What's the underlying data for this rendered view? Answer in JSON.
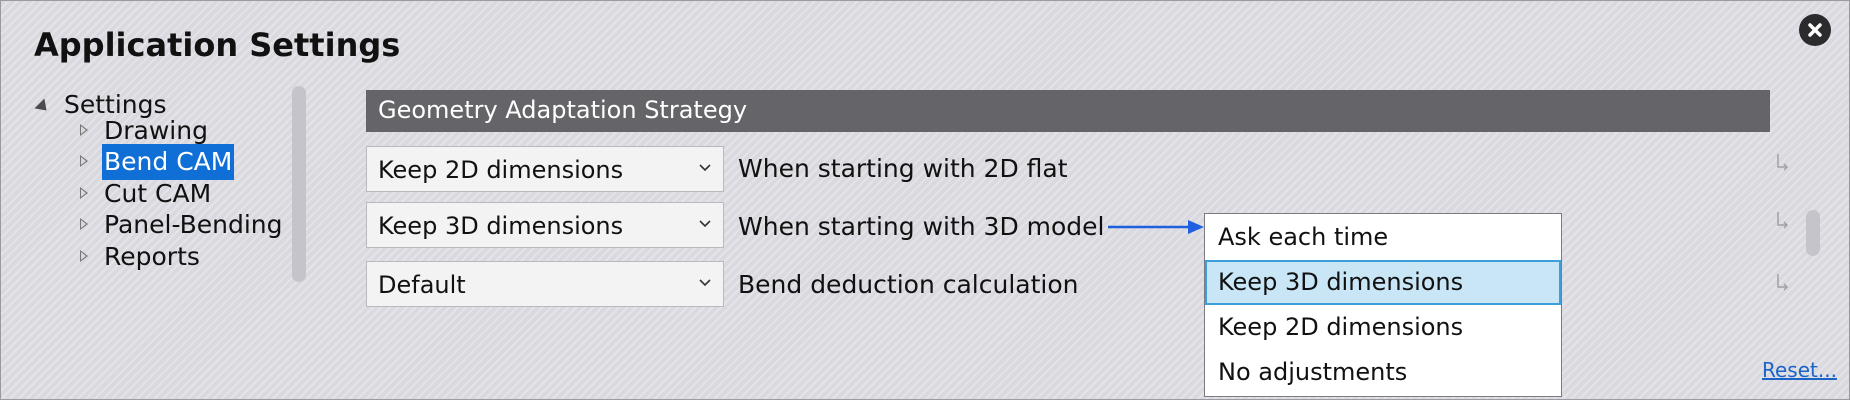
{
  "window": {
    "title": "Application Settings",
    "close_icon": "close-icon"
  },
  "sidebar": {
    "root_label": "Settings",
    "items": [
      {
        "label": "Drawing",
        "selected": false
      },
      {
        "label": "Bend CAM",
        "selected": true
      },
      {
        "label": "Cut CAM",
        "selected": false
      },
      {
        "label": "Panel-Bending",
        "selected": false
      },
      {
        "label": "Reports",
        "selected": false
      }
    ]
  },
  "section": {
    "header": "Geometry Adaptation Strategy",
    "rows": [
      {
        "value": "Keep 2D dimensions",
        "label": "When starting with 2D flat"
      },
      {
        "value": "Keep 3D dimensions",
        "label": "When starting with 3D model"
      },
      {
        "value": "Default",
        "label": "Bend deduction calculation"
      }
    ]
  },
  "dropdown": {
    "options": [
      "Ask each time",
      "Keep 3D dimensions",
      "Keep 2D dimensions",
      "No adjustments"
    ],
    "selected": "Keep 3D dimensions"
  },
  "footer": {
    "reset_label": "Reset..."
  },
  "colors": {
    "selection_blue": "#0f6fd6",
    "header_gray": "#646469",
    "option_highlight": "#c8e6f6",
    "arrow_blue": "#1f5fe0",
    "link_blue": "#1a64c8"
  }
}
